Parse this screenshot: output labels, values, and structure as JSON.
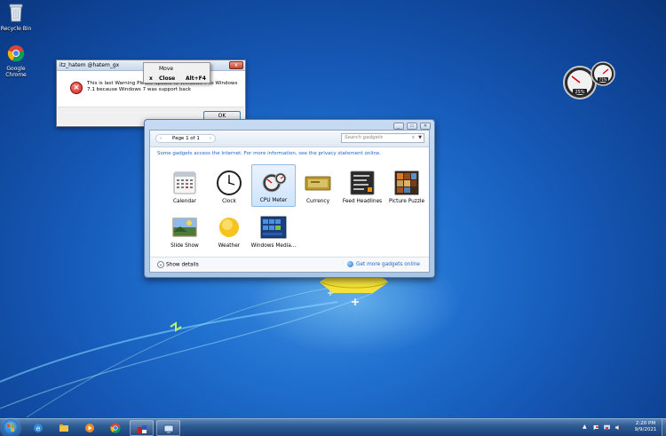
{
  "desktop": {
    "icons": [
      {
        "label": "Recycle Bin"
      },
      {
        "label": "Google Chrome"
      }
    ]
  },
  "dialog": {
    "title": "itz_hatem @hatem_gx",
    "message": "This is last Warning Please update to Windows 7 to Windows 7.1 because Windows 7 was support back",
    "ok_label": "OK",
    "close_glyph": "x"
  },
  "context_menu": {
    "items": [
      {
        "label": "Move",
        "shortcut": "",
        "icon": ""
      },
      {
        "label": "Close",
        "shortcut": "Alt+F4",
        "icon": "x"
      }
    ]
  },
  "gadgets_window": {
    "pager_text": "Page 1 of 1",
    "prev_glyph": "‹",
    "next_glyph": "›",
    "search_placeholder": "Search gadgets",
    "notice": "Some gadgets access the Internet.  For more information, see the privacy statement online.",
    "show_details": "Show details",
    "get_more": "Get more gadgets online",
    "gadgets": [
      {
        "label": "Calendar",
        "icon": "calendar-icon",
        "selected": false
      },
      {
        "label": "Clock",
        "icon": "clock-icon",
        "selected": false
      },
      {
        "label": "CPU Meter",
        "icon": "cpu-meter-icon",
        "selected": true
      },
      {
        "label": "Currency",
        "icon": "currency-icon",
        "selected": false
      },
      {
        "label": "Feed Headlines",
        "icon": "feed-headlines-icon",
        "selected": false
      },
      {
        "label": "Picture Puzzle",
        "icon": "picture-puzzle-icon",
        "selected": false
      },
      {
        "label": "Slide Show",
        "icon": "slide-show-icon",
        "selected": false
      },
      {
        "label": "Weather",
        "icon": "weather-icon",
        "selected": false
      },
      {
        "label": "Windows Media...",
        "icon": "windows-media-icon",
        "selected": false
      }
    ]
  },
  "meter_gadget": {
    "cpu": "25%",
    "memory": "71%"
  },
  "taskbar": {
    "apps": [
      {
        "name": "internet-explorer",
        "open": false
      },
      {
        "name": "file-explorer",
        "open": false
      },
      {
        "name": "media-player",
        "open": false
      },
      {
        "name": "google-chrome",
        "open": false
      },
      {
        "name": "gadgets",
        "open": true
      },
      {
        "name": "remote-desktop",
        "open": true
      }
    ],
    "time": "2:20 PM",
    "date": "9/9/2021"
  }
}
